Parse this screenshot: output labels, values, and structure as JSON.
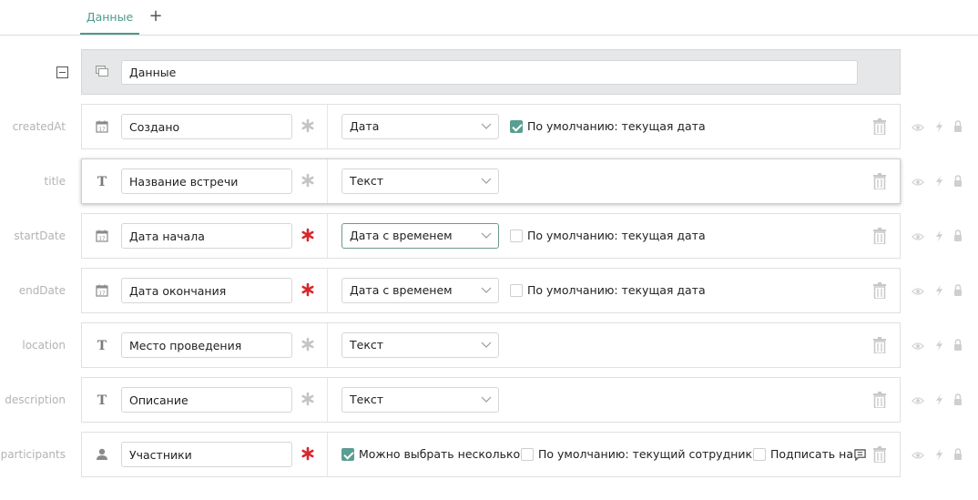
{
  "tabs": [
    {
      "label": "Данные"
    }
  ],
  "tab_add_label": "+",
  "group": {
    "title": "Данные"
  },
  "rows": [
    {
      "key": "createdAt",
      "name": "Создано",
      "type": "Дата",
      "type_icon": "calendar-icon",
      "required": false,
      "checkboxes": [
        {
          "label": "По умолчанию: текущая дата",
          "checked": true
        }
      ]
    },
    {
      "key": "title",
      "name": "Название встречи",
      "type": "Текст",
      "type_icon": "text-type-icon",
      "required": false,
      "checkboxes": []
    },
    {
      "key": "startDate",
      "name": "Дата начала",
      "type": "Дата с временем",
      "type_icon": "calendar-icon",
      "required": true,
      "checkboxes": [
        {
          "label": "По умолчанию: текущая дата",
          "checked": false
        }
      ]
    },
    {
      "key": "endDate",
      "name": "Дата окончания",
      "type": "Дата с временем",
      "type_icon": "calendar-icon",
      "required": true,
      "checkboxes": [
        {
          "label": "По умолчанию: текущая дата",
          "checked": false
        }
      ]
    },
    {
      "key": "location",
      "name": "Место проведения",
      "type": "Текст",
      "type_icon": "text-type-icon",
      "required": false,
      "checkboxes": []
    },
    {
      "key": "description",
      "name": "Описание",
      "type": "Текст",
      "type_icon": "text-type-icon",
      "required": false,
      "checkboxes": []
    },
    {
      "key": "participants",
      "name": "Участники",
      "type": "",
      "type_icon": "user-icon",
      "required": true,
      "checkboxes": [
        {
          "label": "Можно выбрать несколько",
          "checked": true
        },
        {
          "label": "По умолчанию: текущий сотрудник",
          "checked": false
        },
        {
          "label": "Подписать на",
          "checked": false
        }
      ]
    }
  ],
  "colors": {
    "accent": "#4e9a8b",
    "required_active": "#d9262c",
    "required_inactive": "#c4c4c4",
    "icon_muted": "#c8c8c8"
  }
}
